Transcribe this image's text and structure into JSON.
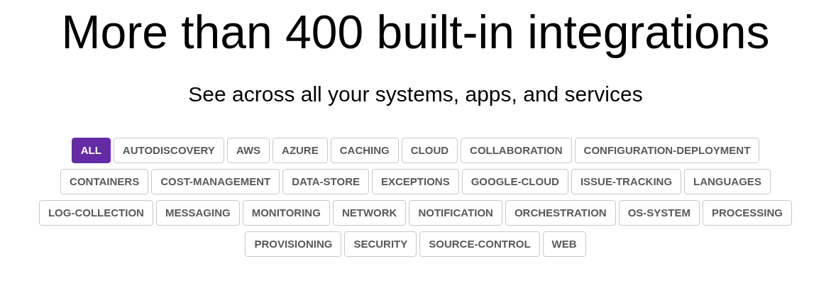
{
  "heading": "More than 400 built-in integrations",
  "subheading": "See across all your systems, apps, and services",
  "filter_rows": [
    [
      {
        "label": "ALL",
        "selected": true
      },
      {
        "label": "AUTODISCOVERY",
        "selected": false
      },
      {
        "label": "AWS",
        "selected": false
      },
      {
        "label": "AZURE",
        "selected": false
      },
      {
        "label": "CACHING",
        "selected": false
      },
      {
        "label": "CLOUD",
        "selected": false
      },
      {
        "label": "COLLABORATION",
        "selected": false
      },
      {
        "label": "CONFIGURATION-DEPLOYMENT",
        "selected": false
      }
    ],
    [
      {
        "label": "CONTAINERS",
        "selected": false
      },
      {
        "label": "COST-MANAGEMENT",
        "selected": false
      },
      {
        "label": "DATA-STORE",
        "selected": false
      },
      {
        "label": "EXCEPTIONS",
        "selected": false
      },
      {
        "label": "GOOGLE-CLOUD",
        "selected": false
      },
      {
        "label": "ISSUE-TRACKING",
        "selected": false
      },
      {
        "label": "LANGUAGES",
        "selected": false
      }
    ],
    [
      {
        "label": "LOG-COLLECTION",
        "selected": false
      },
      {
        "label": "MESSAGING",
        "selected": false
      },
      {
        "label": "MONITORING",
        "selected": false
      },
      {
        "label": "NETWORK",
        "selected": false
      },
      {
        "label": "NOTIFICATION",
        "selected": false
      },
      {
        "label": "ORCHESTRATION",
        "selected": false
      },
      {
        "label": "OS-SYSTEM",
        "selected": false
      },
      {
        "label": "PROCESSING",
        "selected": false
      }
    ],
    [
      {
        "label": "PROVISIONING",
        "selected": false
      },
      {
        "label": "SECURITY",
        "selected": false
      },
      {
        "label": "SOURCE-CONTROL",
        "selected": false
      },
      {
        "label": "WEB",
        "selected": false
      }
    ]
  ]
}
